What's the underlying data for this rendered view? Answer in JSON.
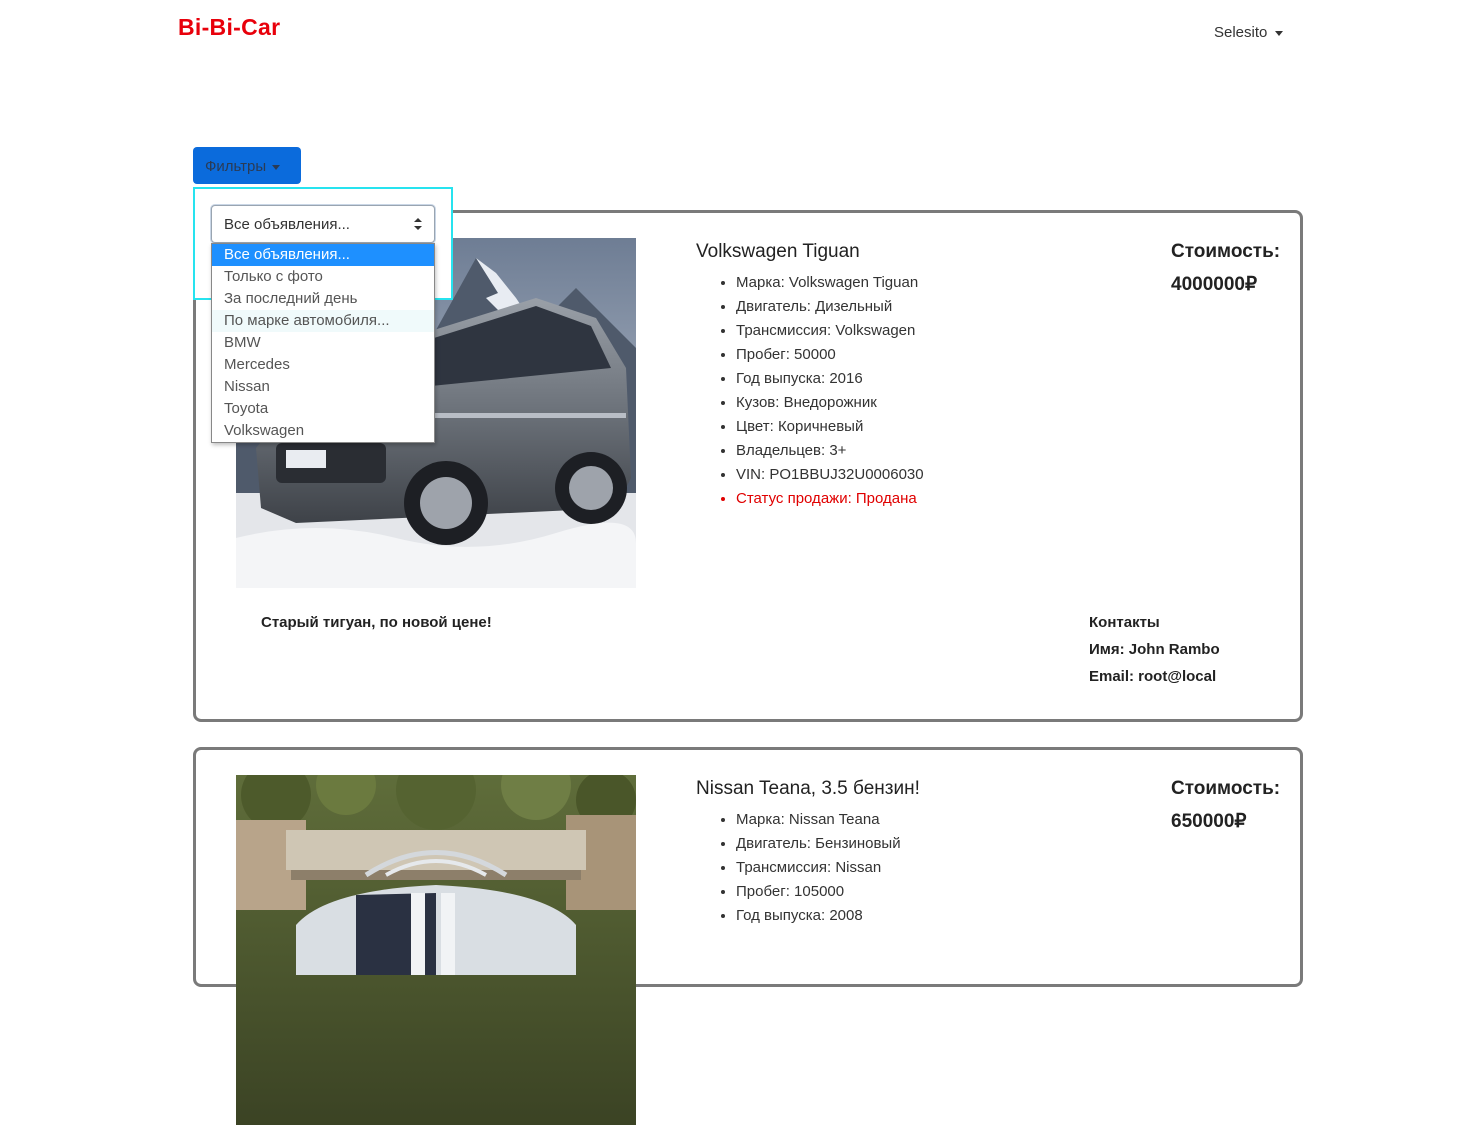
{
  "navbar": {
    "brand": "Bi-Bi-Car",
    "user": "Selesito"
  },
  "filters": {
    "button_label": "Фильтры",
    "select_value": "Все объявления...",
    "options": [
      "Все объявления...",
      "Только с фото",
      "За последний день",
      "По марке автомобиля...",
      "BMW",
      "Mercedes",
      "Nissan",
      "Toyota",
      "Volkswagen"
    ]
  },
  "listings": [
    {
      "title": "Volkswagen Tiguan",
      "specs": [
        "Марка: Volkswagen Tiguan",
        "Двигатель: Дизельный",
        "Трансмиссия: Volkswagen",
        "Пробег: 50000",
        "Год выпуска: 2016",
        "Кузов: Внедорожник",
        "Цвет: Коричневый",
        "Владельцев: 3+",
        "VIN: PO1BBUJ32U0006030",
        "Статус продажи: Продана"
      ],
      "price_label": "Стоимость:",
      "price": "4000000₽",
      "description": "Старый тигуан, по новой цене!",
      "contacts": {
        "heading": "Контакты",
        "name": "Имя: John Rambo",
        "email": "Email: root@local"
      }
    },
    {
      "title": "Nissan Teana, 3.5 бензин!",
      "specs": [
        "Марка: Nissan Teana",
        "Двигатель: Бензиновый",
        "Трансмиссия: Nissan",
        "Пробег: 105000",
        "Год выпуска: 2008"
      ],
      "price_label": "Стоимость:",
      "price": "650000₽"
    }
  ],
  "colors": {
    "brand": "#e8000b",
    "accent": "#0b6bdc",
    "focus": "#26e3ef",
    "sold_status": "#e00000"
  }
}
